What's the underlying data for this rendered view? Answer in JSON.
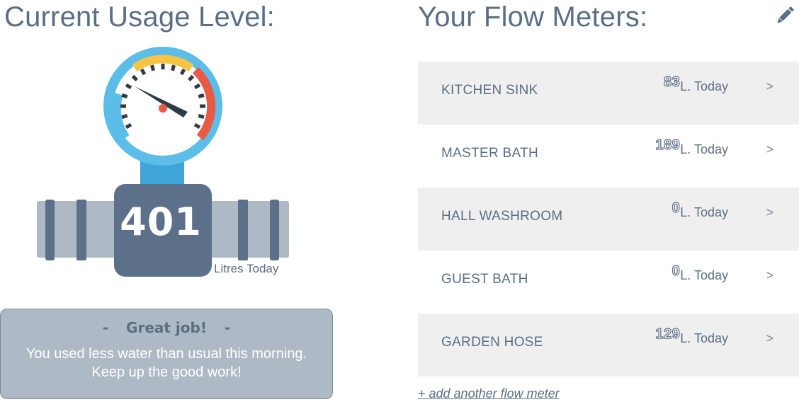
{
  "usage": {
    "title": "Current Usage Level:",
    "total": "401",
    "unit": "Litres Today"
  },
  "message": {
    "dash_left": "-",
    "heading": "Great job!",
    "dash_right": "-",
    "body_line1": "You used less water than usual this morning.",
    "body_line2": "Keep up the good work!"
  },
  "meters": {
    "title": "Your Flow Meters:",
    "edit_icon": "pencil-icon",
    "unit_label": "L. Today",
    "chevron": ">",
    "items": [
      {
        "name": "KITCHEN SINK",
        "value": "83"
      },
      {
        "name": "MASTER BATH",
        "value": "189"
      },
      {
        "name": "HALL WASHROOM",
        "value": "0"
      },
      {
        "name": "GUEST BATH",
        "value": "0"
      },
      {
        "name": "GARDEN HOSE",
        "value": "129"
      }
    ],
    "add_link": "+ add another flow meter"
  },
  "colors": {
    "text": "#5a6f86",
    "row_shade": "#efefef",
    "card_bg": "#adb9c4",
    "gauge_ring": "#5bbde8",
    "gauge_red": "#e85a44",
    "gauge_yellow": "#f6c343",
    "pipe": "#adb9c4",
    "pipe_dark": "#5d7089"
  }
}
